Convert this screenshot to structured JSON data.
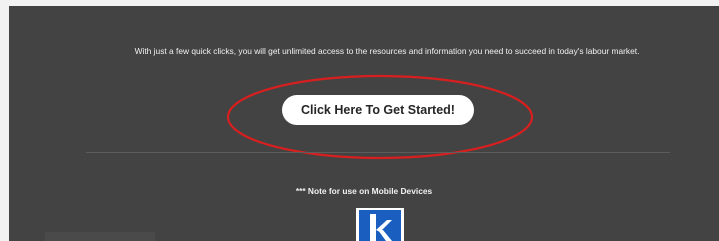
{
  "intro": {
    "text": "With just a few quick clicks, you will get unlimited access to the resources and information you need to succeed in today's labour market."
  },
  "cta": {
    "label": "Click Here To Get Started!"
  },
  "annotation": {
    "color": "#d81f1f"
  },
  "mobile_note": {
    "text": "*** Note for use on Mobile Devices"
  },
  "logo": {
    "icon": "k-logo-icon",
    "color": "#1a5fc0"
  },
  "colors": {
    "background": "#434343",
    "text": "#f1f1f1",
    "button_bg": "#ffffff",
    "button_text": "#262626"
  }
}
